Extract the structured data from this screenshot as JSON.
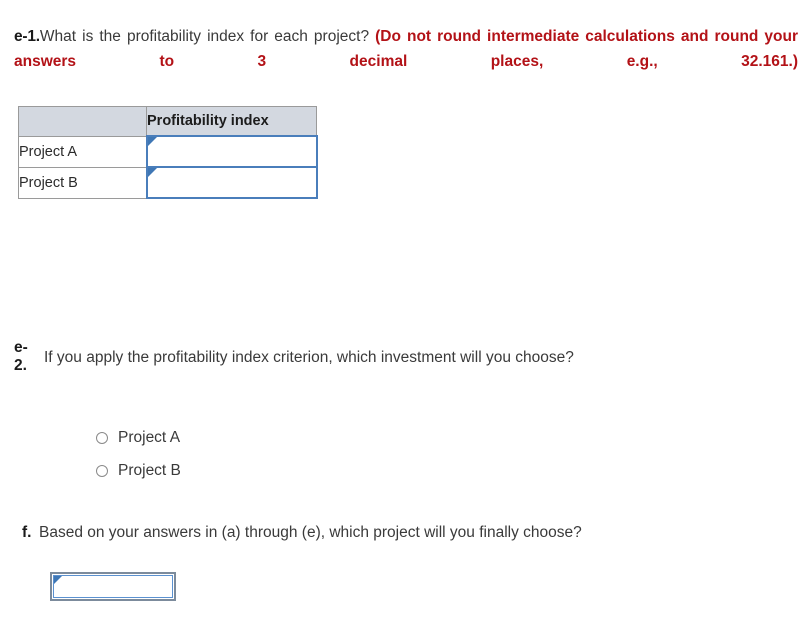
{
  "questions": {
    "e1": {
      "label": "e-1.",
      "text": "What is the profitability index for each project?",
      "note": "(Do not round intermediate calculations and round your answers to 3 decimal places, e.g., 32.161.)"
    },
    "e2": {
      "label_line1": "e-",
      "label_line2": "2.",
      "text": "If you apply the profitability index criterion, which investment will you choose?",
      "options": [
        {
          "label": "Project A",
          "selected": false
        },
        {
          "label": "Project B",
          "selected": false
        }
      ]
    },
    "f": {
      "label": "f.",
      "text": "Based on your answers in (a) through (e), which project will you finally choose?",
      "answer_value": "",
      "answer_placeholder": ""
    }
  },
  "table": {
    "headers": [
      "",
      "Profitability index"
    ],
    "rows": [
      {
        "label": "Project A",
        "value": "",
        "placeholder": ""
      },
      {
        "label": "Project B",
        "value": "",
        "placeholder": ""
      }
    ]
  },
  "colors": {
    "header_fill": "#d3d8e0",
    "input_border": "#4a7ebb",
    "note_red": "#b31217",
    "marker_blue": "#3f77b5",
    "text": "#3a3a3a"
  }
}
